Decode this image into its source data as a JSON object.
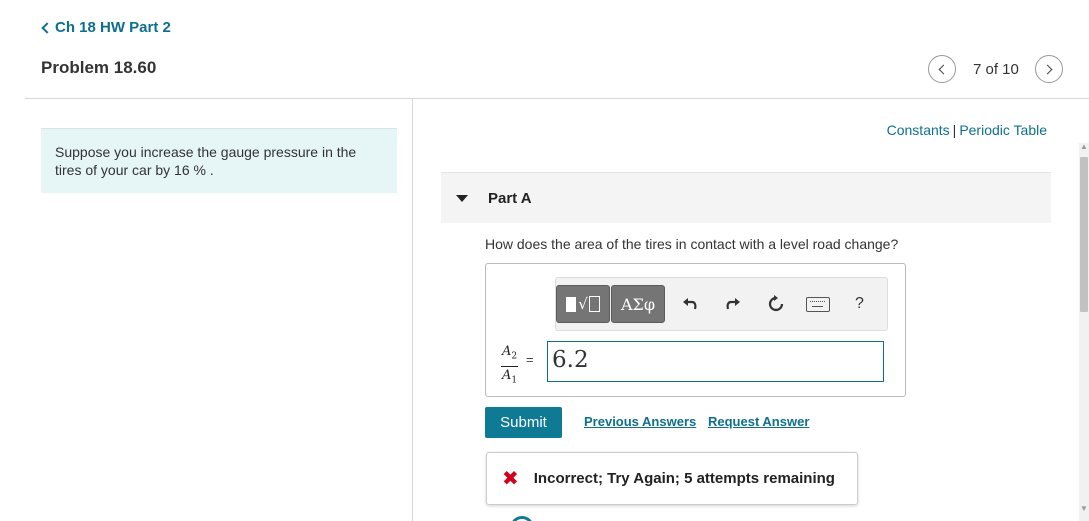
{
  "nav": {
    "back_label": "Ch 18 HW Part 2",
    "problem_title": "Problem 18.60",
    "pager": {
      "position": "7 of 10"
    }
  },
  "intro": {
    "text": "Suppose you increase the gauge pressure in the tires of your car by 16 % ."
  },
  "links": {
    "constants": "Constants",
    "separator": "|",
    "periodic_table": "Periodic Table"
  },
  "part": {
    "label": "Part A",
    "question": "How does the area of the tires in contact with a level road change?"
  },
  "toolbar": {
    "greek_label": "ΑΣφ",
    "help_label": "?"
  },
  "answer": {
    "fraction": {
      "numerator_var": "A",
      "numerator_sub": "2",
      "denominator_var": "A",
      "denominator_sub": "1"
    },
    "equals": "=",
    "value": "6.2"
  },
  "actions": {
    "submit": "Submit",
    "previous_answers": "Previous Answers",
    "request_answer": "Request Answer"
  },
  "feedback": {
    "message": "Incorrect; Try Again; 5 attempts remaining"
  },
  "colors": {
    "accent": "#0e6f8e",
    "submit_bg": "#0e7a94",
    "intro_bg": "#e6f5f6",
    "error": "#d0021b"
  }
}
